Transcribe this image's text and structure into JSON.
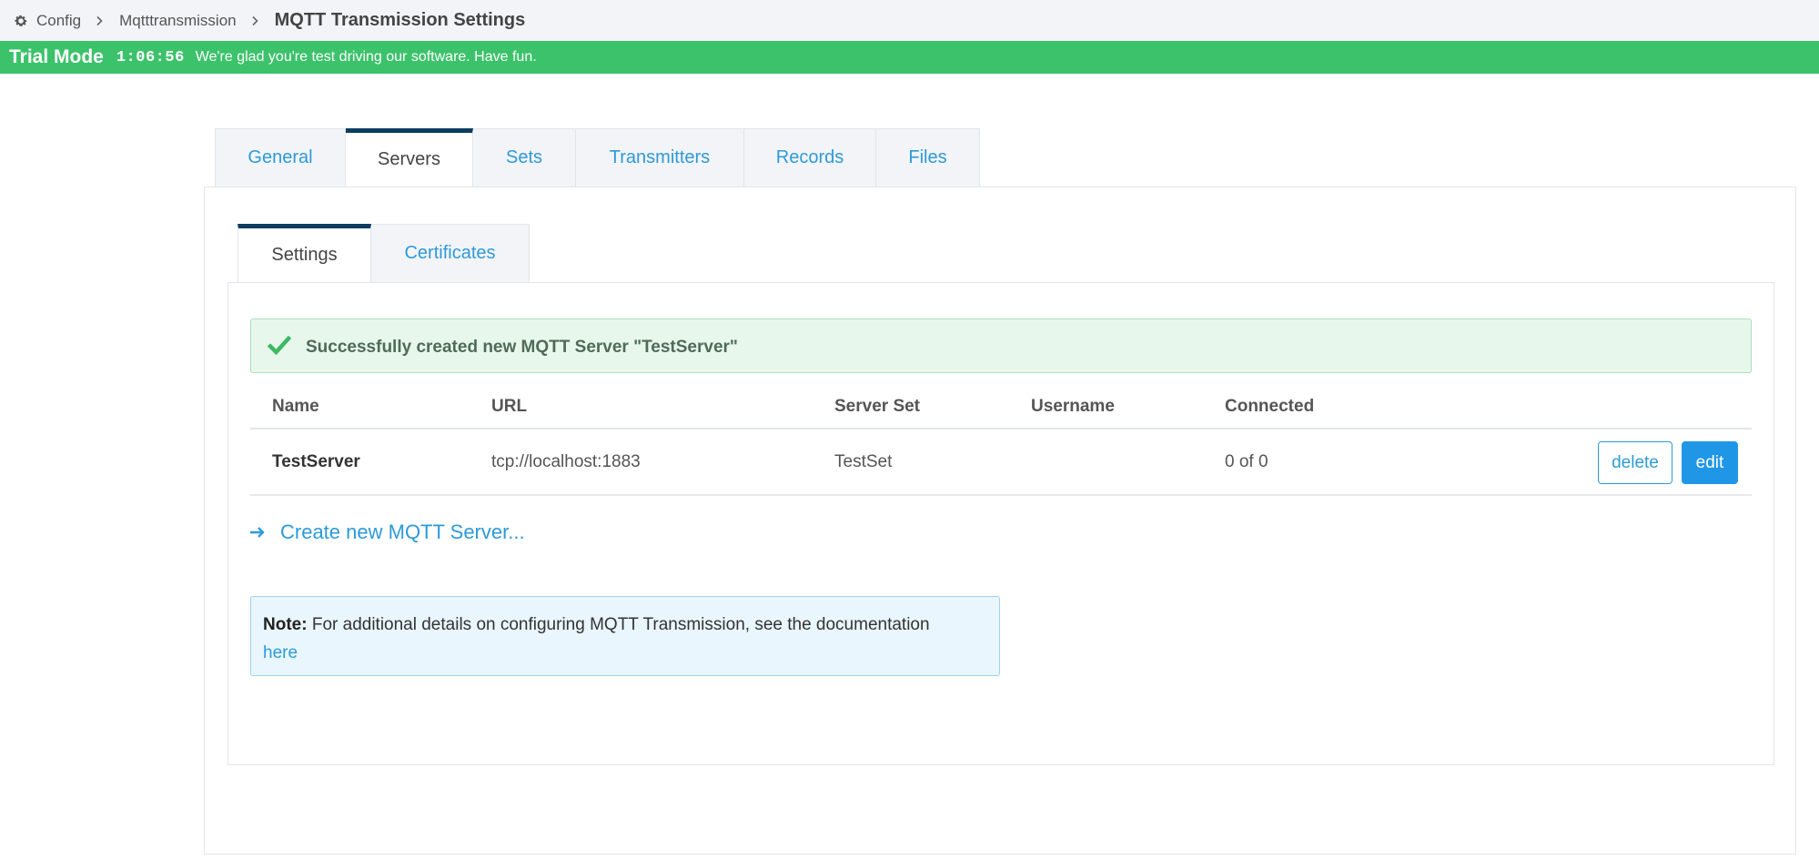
{
  "breadcrumb": {
    "items": [
      "Config",
      "Mqtttransmission"
    ],
    "current": "MQTT Transmission Settings"
  },
  "trial": {
    "mode": "Trial Mode",
    "timer": "1:06:56",
    "message": "We're glad you're test driving our software. Have fun."
  },
  "outer_tabs": [
    {
      "label": "General",
      "active": false
    },
    {
      "label": "Servers",
      "active": true
    },
    {
      "label": "Sets",
      "active": false
    },
    {
      "label": "Transmitters",
      "active": false
    },
    {
      "label": "Records",
      "active": false
    },
    {
      "label": "Files",
      "active": false
    }
  ],
  "inner_tabs": [
    {
      "label": "Settings",
      "active": true
    },
    {
      "label": "Certificates",
      "active": false
    }
  ],
  "alert": {
    "text": "Successfully created new MQTT Server \"TestServer\""
  },
  "table": {
    "headers": [
      "Name",
      "URL",
      "Server Set",
      "Username",
      "Connected"
    ],
    "rows": [
      {
        "name": "TestServer",
        "url": "tcp://localhost:1883",
        "server_set": "TestSet",
        "username": "",
        "connected": "0 of 0"
      }
    ],
    "delete_label": "delete",
    "edit_label": "edit"
  },
  "create_link": "Create new MQTT Server...",
  "note": {
    "label": "Note:",
    "text": "For additional details on configuring MQTT Transmission, see the documentation",
    "link": "here"
  },
  "colors": {
    "trial_green": "#3cc26b",
    "link_blue": "#2d9ad8",
    "active_tab_border": "#0d3c61",
    "edit_button": "#2097e6"
  },
  "icons": {
    "breadcrumb_root": "gear-icon",
    "breadcrumb_separator": "chevron-right-icon",
    "alert": "checkmark-icon",
    "create": "arrow-right-icon"
  }
}
